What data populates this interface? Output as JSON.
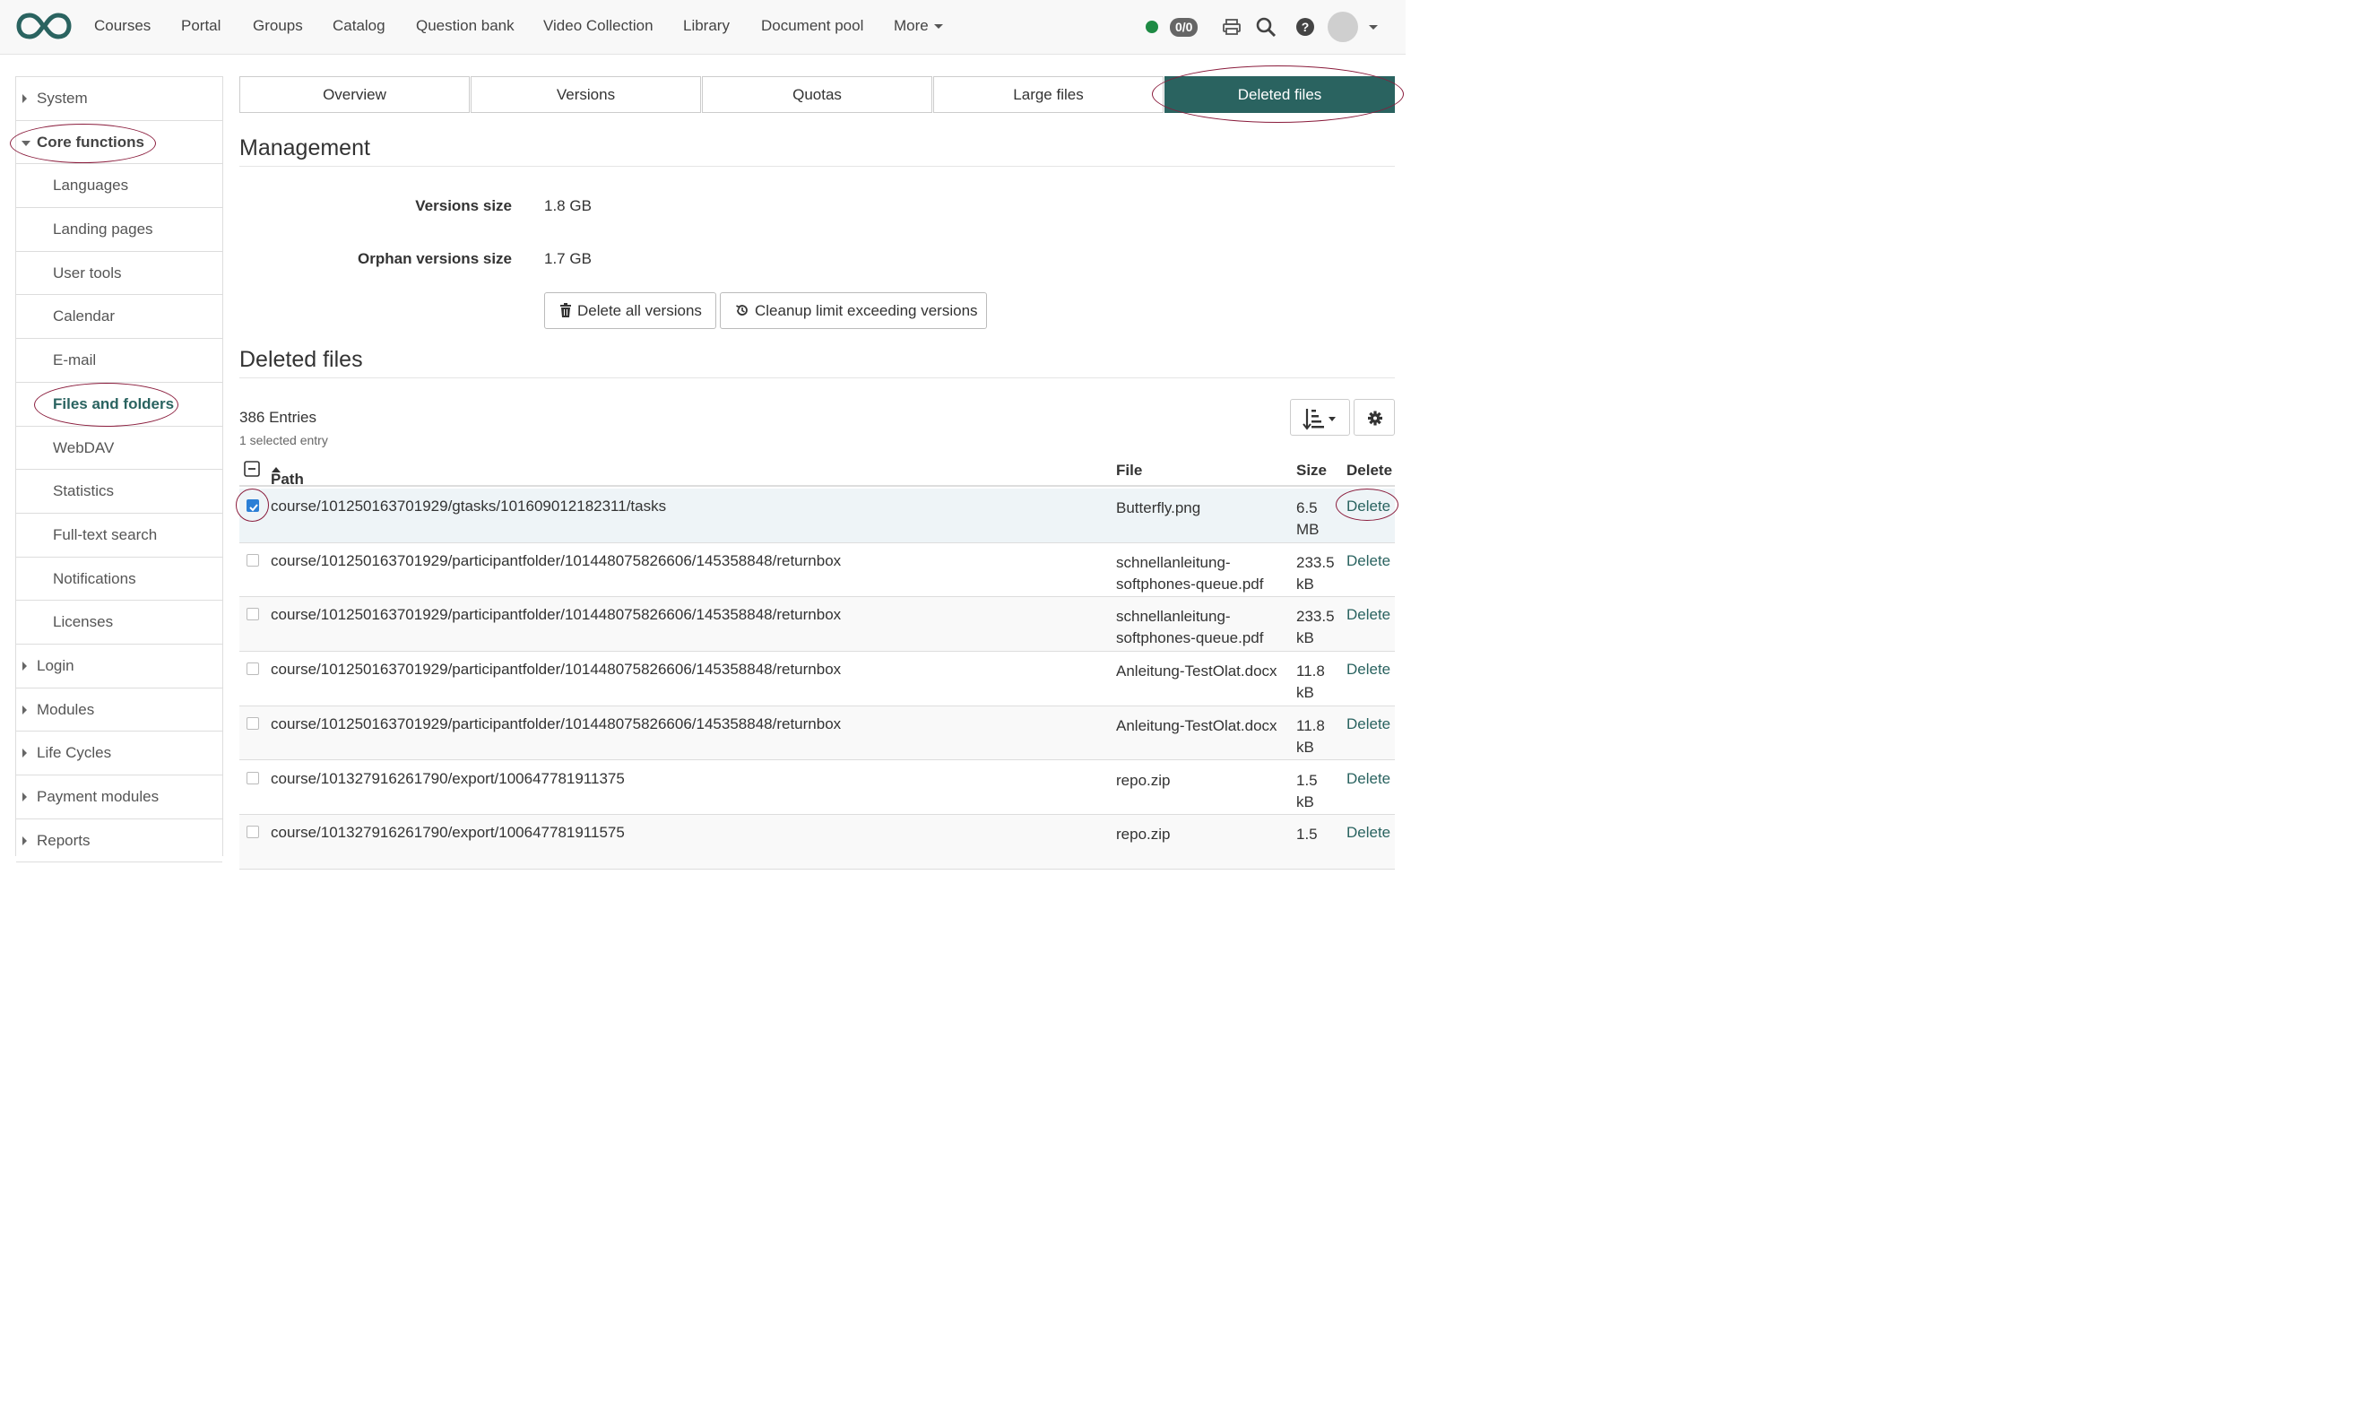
{
  "nav": {
    "items": [
      "Courses",
      "Portal",
      "Groups",
      "Catalog",
      "Question bank",
      "Video Collection",
      "Library",
      "Document pool"
    ],
    "more_label": "More",
    "counter": "0/0",
    "status_color": "#1e8a44"
  },
  "sidebar": {
    "items": [
      {
        "label": "System",
        "level": 1,
        "state": "collapsed"
      },
      {
        "label": "Core functions",
        "level": 1,
        "state": "expanded"
      },
      {
        "label": "Languages",
        "level": 2
      },
      {
        "label": "Landing pages",
        "level": 2
      },
      {
        "label": "User tools",
        "level": 2
      },
      {
        "label": "Calendar",
        "level": 2
      },
      {
        "label": "E-mail",
        "level": 2
      },
      {
        "label": "Files and folders",
        "level": 2,
        "active": true
      },
      {
        "label": "WebDAV",
        "level": 2
      },
      {
        "label": "Statistics",
        "level": 2
      },
      {
        "label": "Full-text search",
        "level": 2
      },
      {
        "label": "Notifications",
        "level": 2
      },
      {
        "label": "Licenses",
        "level": 2
      },
      {
        "label": "Login",
        "level": 1,
        "state": "collapsed"
      },
      {
        "label": "Modules",
        "level": 1,
        "state": "collapsed"
      },
      {
        "label": "Life Cycles",
        "level": 1,
        "state": "collapsed"
      },
      {
        "label": "Payment modules",
        "level": 1,
        "state": "collapsed"
      },
      {
        "label": "Reports",
        "level": 1,
        "state": "collapsed"
      }
    ]
  },
  "tabs": [
    "Overview",
    "Versions",
    "Quotas",
    "Large files",
    "Deleted files"
  ],
  "management": {
    "title": "Management",
    "versions_size_label": "Versions size",
    "versions_size_value": "1.8 GB",
    "orphan_label": "Orphan versions size",
    "orphan_value": "1.7 GB",
    "delete_all_label": "Delete all versions",
    "cleanup_label": "Cleanup limit exceeding versions"
  },
  "deleted": {
    "title": "Deleted files",
    "entries": "386 Entries",
    "selected": "1 selected entry",
    "columns": {
      "path": "Path",
      "file": "File",
      "size": "Size",
      "delete": "Delete"
    },
    "rows": [
      {
        "path": "course/101250163701929/gtasks/101609012182311/tasks",
        "file": "Butterfly.png",
        "size": "6.5 MB",
        "checked": true,
        "action": "Delete"
      },
      {
        "path": "course/101250163701929/participantfolder/101448075826606/145358848/returnbox",
        "file": "schnellanleitung-softphones-queue.pdf",
        "size": "233.5 kB",
        "checked": false,
        "action": "Delete"
      },
      {
        "path": "course/101250163701929/participantfolder/101448075826606/145358848/returnbox",
        "file": "schnellanleitung-softphones-queue.pdf",
        "size": "233.5 kB",
        "checked": false,
        "action": "Delete"
      },
      {
        "path": "course/101250163701929/participantfolder/101448075826606/145358848/returnbox",
        "file": "Anleitung-TestOlat.docx",
        "size": "11.8 kB",
        "checked": false,
        "action": "Delete"
      },
      {
        "path": "course/101250163701929/participantfolder/101448075826606/145358848/returnbox",
        "file": "Anleitung-TestOlat.docx",
        "size": "11.8 kB",
        "checked": false,
        "action": "Delete"
      },
      {
        "path": "course/101327916261790/export/100647781911375",
        "file": "repo.zip",
        "size": "1.5 kB",
        "checked": false,
        "action": "Delete"
      },
      {
        "path": "course/101327916261790/export/100647781911575",
        "file": "repo.zip",
        "size": "1.5",
        "checked": false,
        "action": "Delete"
      }
    ]
  },
  "colors": {
    "accent": "#2a6360",
    "highlight_ring": "#8a1c3c",
    "checkbox": "#2b7fd6"
  }
}
